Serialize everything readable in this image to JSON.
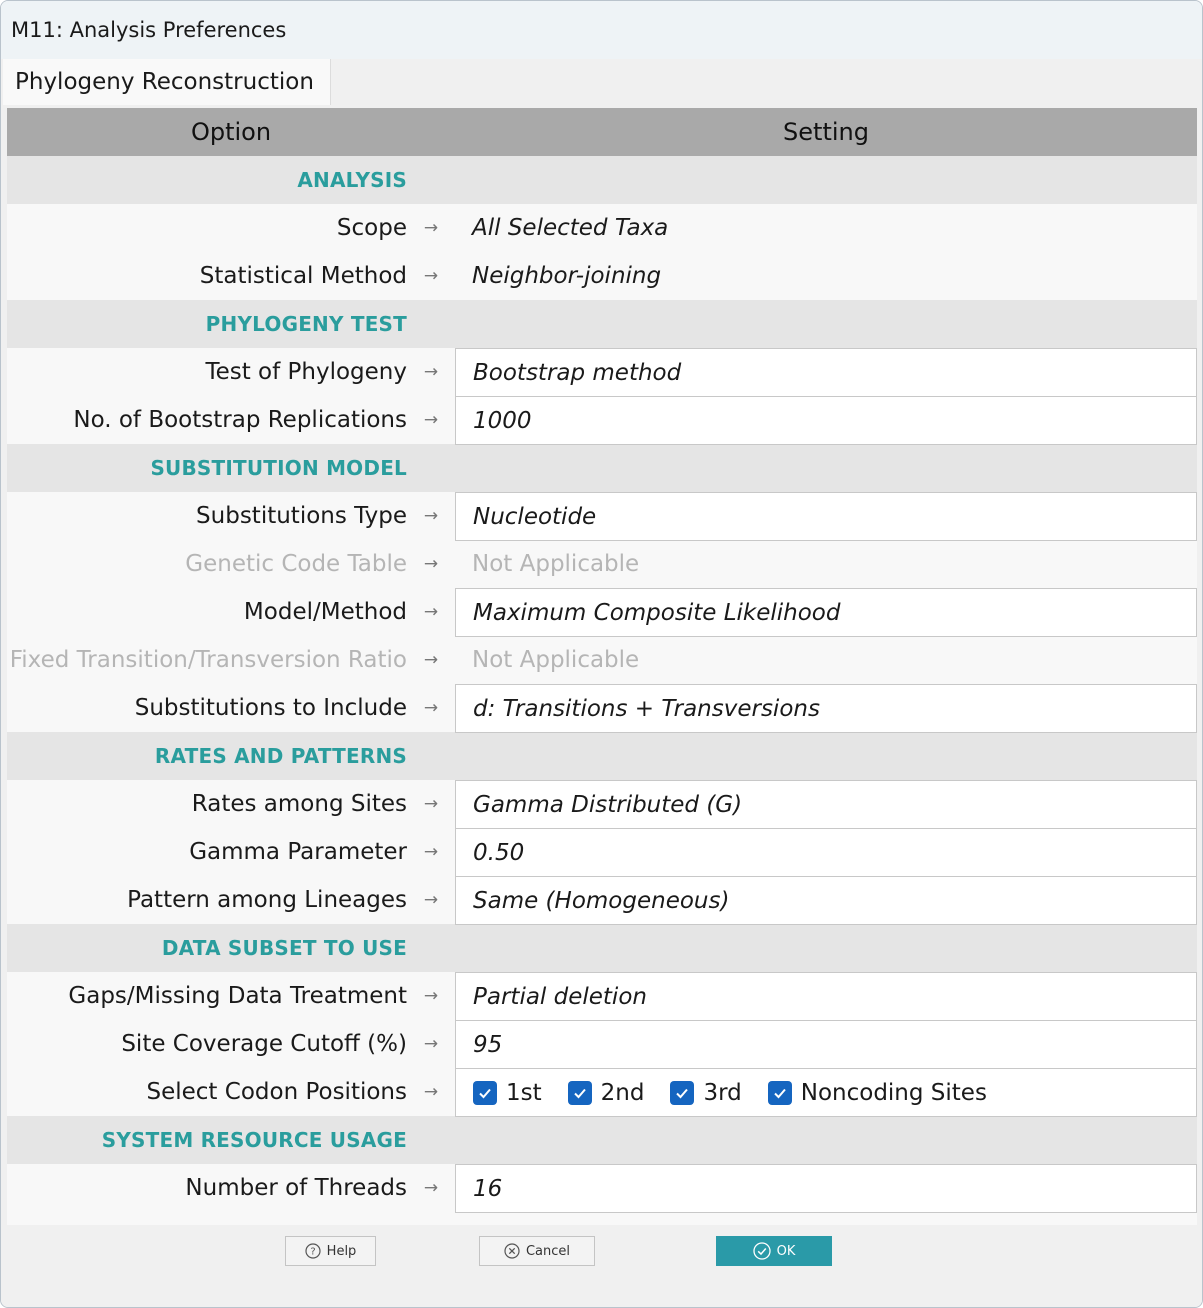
{
  "window": {
    "title": "M11: Analysis Preferences"
  },
  "tabs": [
    {
      "label": "Phylogeny Reconstruction"
    }
  ],
  "grid": {
    "header": {
      "option": "Option",
      "setting": "Setting"
    },
    "sections": {
      "analysis": "ANALYSIS",
      "phylogeny_test": "PHYLOGENY TEST",
      "substitution_model": "SUBSTITUTION MODEL",
      "rates_and_patterns": "RATES AND PATTERNS",
      "data_subset": "DATA SUBSET TO USE",
      "system_resource": "SYSTEM RESOURCE USAGE"
    },
    "rows": {
      "scope": {
        "label": "Scope",
        "value": "All Selected Taxa"
      },
      "statistical_method": {
        "label": "Statistical Method",
        "value": "Neighbor-joining"
      },
      "test_of_phylogeny": {
        "label": "Test of Phylogeny",
        "value": "Bootstrap method"
      },
      "bootstrap_replications": {
        "label": "No. of Bootstrap Replications",
        "value": "1000"
      },
      "substitutions_type": {
        "label": "Substitutions Type",
        "value": "Nucleotide"
      },
      "genetic_code_table": {
        "label": "Genetic Code Table",
        "value": "Not Applicable"
      },
      "model_method": {
        "label": "Model/Method",
        "value": "Maximum Composite Likelihood"
      },
      "fixed_ratio": {
        "label": "Fixed Transition/Transversion Ratio",
        "value": "Not Applicable"
      },
      "substitutions_to_include": {
        "label": "Substitutions to Include",
        "value": "d: Transitions + Transversions"
      },
      "rates_among_sites": {
        "label": "Rates among Sites",
        "value": "Gamma Distributed (G)"
      },
      "gamma_parameter": {
        "label": "Gamma Parameter",
        "value": "0.50"
      },
      "pattern_among_lineages": {
        "label": "Pattern among Lineages",
        "value": "Same (Homogeneous)"
      },
      "gaps_missing": {
        "label": "Gaps/Missing Data Treatment",
        "value": "Partial deletion"
      },
      "site_coverage": {
        "label": "Site Coverage Cutoff (%)",
        "value": "95"
      },
      "codon_positions": {
        "label": "Select Codon Positions",
        "options": [
          {
            "label": "1st",
            "checked": true
          },
          {
            "label": "2nd",
            "checked": true
          },
          {
            "label": "3rd",
            "checked": true
          },
          {
            "label": "Noncoding Sites",
            "checked": true
          }
        ]
      },
      "threads": {
        "label": "Number of Threads",
        "value": "16"
      }
    },
    "arrow_glyph": "→"
  },
  "footer": {
    "help_label": "Help",
    "cancel_label": "Cancel",
    "ok_label": "OK"
  },
  "colors": {
    "section_heading": "#2a9d9d",
    "header_bg": "#a9a9a9",
    "ok_button": "#2a9aa8",
    "checkbox": "#1565c0",
    "disabled_text": "#b5b5b5"
  }
}
